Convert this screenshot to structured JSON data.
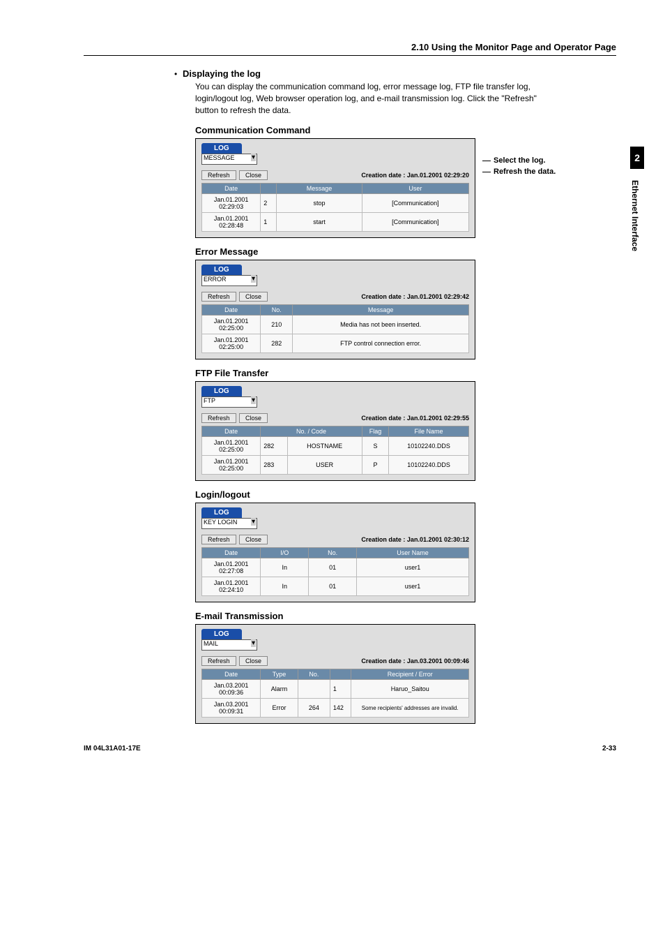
{
  "header": {
    "title": "2.10  Using the Monitor Page and Operator Page"
  },
  "side": {
    "chapter": "2",
    "label": "Ethernet Interface"
  },
  "bullet": {
    "dot": "•",
    "title": "Displaying the log"
  },
  "intro": "You can display the communication command log, error message log, FTP file transfer log, login/logout log, Web browser operation log, and e-mail transmission log.  Click the \"Refresh\" button to refresh the data.",
  "annotations": {
    "select": "Select the log.",
    "refresh": "Refresh the data."
  },
  "common": {
    "log_tab": "LOG",
    "refresh_btn": "Refresh",
    "close_btn": "Close"
  },
  "panels": {
    "comm": {
      "heading": "Communication Command",
      "select": "MESSAGE",
      "creation": "Creation date : Jan.01.2001 02:29:20",
      "cols": [
        "Date",
        "",
        "Message",
        "User"
      ],
      "rows": [
        {
          "date": "Jan.01.2001 02:29:03",
          "n": "2",
          "msg": "stop",
          "user": "[Communication]"
        },
        {
          "date": "Jan.01.2001 02:28:48",
          "n": "1",
          "msg": "start",
          "user": "[Communication]"
        }
      ]
    },
    "error": {
      "heading": "Error Message",
      "select": "ERROR",
      "creation": "Creation date : Jan.01.2001 02:29:42",
      "cols": [
        "Date",
        "No.",
        "Message"
      ],
      "rows": [
        {
          "date": "Jan.01.2001 02:25:00",
          "no": "210",
          "msg": "Media has not been inserted."
        },
        {
          "date": "Jan.01.2001 02:25:00",
          "no": "282",
          "msg": "FTP control connection error."
        }
      ]
    },
    "ftp": {
      "heading": "FTP File Transfer",
      "select": "FTP",
      "creation": "Creation date : Jan.01.2001 02:29:55",
      "cols": [
        "Date",
        "No. / Code",
        "Flag",
        "File Name"
      ],
      "rows": [
        {
          "date": "Jan.01.2001 02:25:00",
          "no": "282",
          "code": "HOSTNAME",
          "flag": "S",
          "file": "10102240.DDS"
        },
        {
          "date": "Jan.01.2001 02:25:00",
          "no": "283",
          "code": "USER",
          "flag": "P",
          "file": "10102240.DDS"
        }
      ]
    },
    "login": {
      "heading": "Login/logout",
      "select": "KEY LOGIN",
      "creation": "Creation date : Jan.01.2001 02:30:12",
      "cols": [
        "Date",
        "I/O",
        "No.",
        "User Name"
      ],
      "rows": [
        {
          "date": "Jan.01.2001 02:27:08",
          "io": "In",
          "no": "01",
          "user": "user1"
        },
        {
          "date": "Jan.01.2001 02:24:10",
          "io": "In",
          "no": "01",
          "user": "user1"
        }
      ]
    },
    "mail": {
      "heading": "E-mail Transmission",
      "select": "MAIL",
      "creation": "Creation date : Jan.03.2001 00:09:46",
      "cols": [
        "Date",
        "Type",
        "No.",
        "",
        "Recipient / Error"
      ],
      "rows": [
        {
          "date": "Jan.03.2001 00:09:36",
          "type": "Alarm",
          "no": "",
          "n2": "1",
          "re": "Haruo_Saitou"
        },
        {
          "date": "Jan.03.2001 00:09:31",
          "type": "Error",
          "no": "264",
          "n2": "142",
          "re": "Some recipients' addresses are invalid."
        }
      ]
    }
  },
  "footer": {
    "left": "IM 04L31A01-17E",
    "right": "2-33"
  }
}
